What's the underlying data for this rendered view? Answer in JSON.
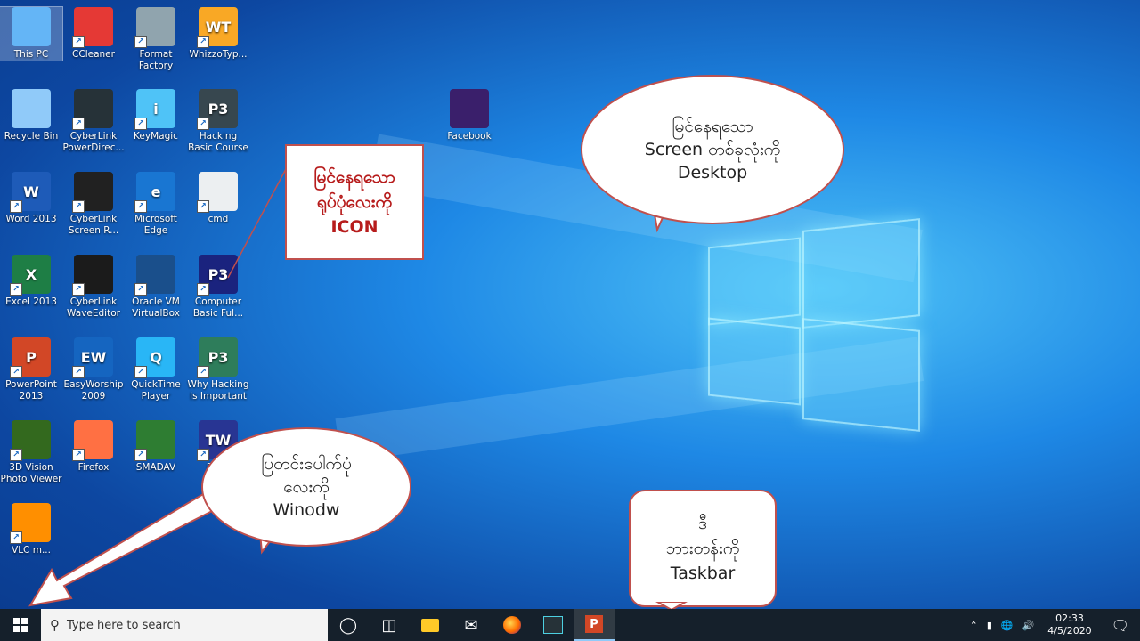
{
  "desktop": {
    "icons": [
      {
        "label": "This PC",
        "glyph": "pc-icon",
        "color": "#64b5f6"
      },
      {
        "label": "CCleaner",
        "glyph": "ccleaner-icon",
        "color": "#e53935"
      },
      {
        "label": "Format Factory",
        "glyph": "format-factory-icon",
        "color": "#90a4ae"
      },
      {
        "label": "WhizzoTyp...",
        "glyph": "whizzotype-icon",
        "color": "#f9a825",
        "text": "WT"
      },
      {
        "label": "Recycle Bin",
        "glyph": "recycle-bin-icon",
        "color": "#90caf9"
      },
      {
        "label": "CyberLink PowerDirec...",
        "glyph": "powerdirector-icon",
        "color": "#263238"
      },
      {
        "label": "KeyMagic",
        "glyph": "keymagic-icon",
        "color": "#4fc3f7",
        "text": "i"
      },
      {
        "label": "Hacking Basic Course",
        "glyph": "pptx-file-icon",
        "color": "#37474f",
        "text": "P3"
      },
      {
        "label": "Word 2013",
        "glyph": "word-icon",
        "color": "#1e5bb8",
        "text": "W"
      },
      {
        "label": "CyberLink Screen R...",
        "glyph": "screen-recorder-icon",
        "color": "#212121"
      },
      {
        "label": "Microsoft Edge",
        "glyph": "edge-icon",
        "color": "#1976d2",
        "text": "e"
      },
      {
        "label": "cmd",
        "glyph": "file-icon",
        "color": "#eceff1"
      },
      {
        "label": "Excel 2013",
        "glyph": "excel-icon",
        "color": "#1e7e45",
        "text": "X"
      },
      {
        "label": "CyberLink WaveEditor",
        "glyph": "waveeditor-icon",
        "color": "#1b1b1b"
      },
      {
        "label": "Oracle VM VirtualBox",
        "glyph": "virtualbox-icon",
        "color": "#1a4f8b"
      },
      {
        "label": "Computer Basic Ful...",
        "glyph": "pptx-file-icon",
        "color": "#1a237e",
        "text": "P3"
      },
      {
        "label": "PowerPoint 2013",
        "glyph": "powerpoint-icon",
        "color": "#d24726",
        "text": "P"
      },
      {
        "label": "EasyWorship 2009",
        "glyph": "easyworship-icon",
        "color": "#1565c0",
        "text": "EW"
      },
      {
        "label": "QuickTime Player",
        "glyph": "quicktime-icon",
        "color": "#29b6f6",
        "text": "Q"
      },
      {
        "label": "Why Hacking Is Important",
        "glyph": "pptx-file-icon",
        "color": "#2e7d5b",
        "text": "P3"
      },
      {
        "label": "3D Vision Photo Viewer",
        "glyph": "3d-vision-icon",
        "color": "#33691e"
      },
      {
        "label": "Firefox",
        "glyph": "firefox-icon",
        "color": "#ff7043"
      },
      {
        "label": "SMADAV",
        "glyph": "smadav-icon",
        "color": "#2e7d32"
      },
      {
        "label": "Bible",
        "glyph": "bible-icon",
        "color": "#283593",
        "text": "TW"
      },
      {
        "label": "VLC m...",
        "glyph": "vlc-icon",
        "color": "#ff8f00"
      },
      {
        "label": "Facebook",
        "glyph": "facebook-firefox-icon",
        "color": "#3a1f6b"
      }
    ]
  },
  "callouts": {
    "icon_box": {
      "line1": "မြင်နေရသော",
      "line2": "ရုပ်ပုံလေးကို",
      "line3": "ICON"
    },
    "desktop_bubble": {
      "line1": "မြင်နေရသော",
      "line2": "Screen တစ်ခုလုံးကို",
      "line3": "Desktop"
    },
    "window_bubble": {
      "line1": "ပြတင်းပေါက်ပုံ",
      "line2": "လေးကို",
      "line3": "Winodw"
    },
    "taskbar_box": {
      "line1": "ဒီ",
      "line2": "ဘားတန်းကို",
      "line3": "Taskbar"
    }
  },
  "taskbar": {
    "search_placeholder": "Type here to search",
    "time": "02:33",
    "date": "4/5/2020"
  }
}
